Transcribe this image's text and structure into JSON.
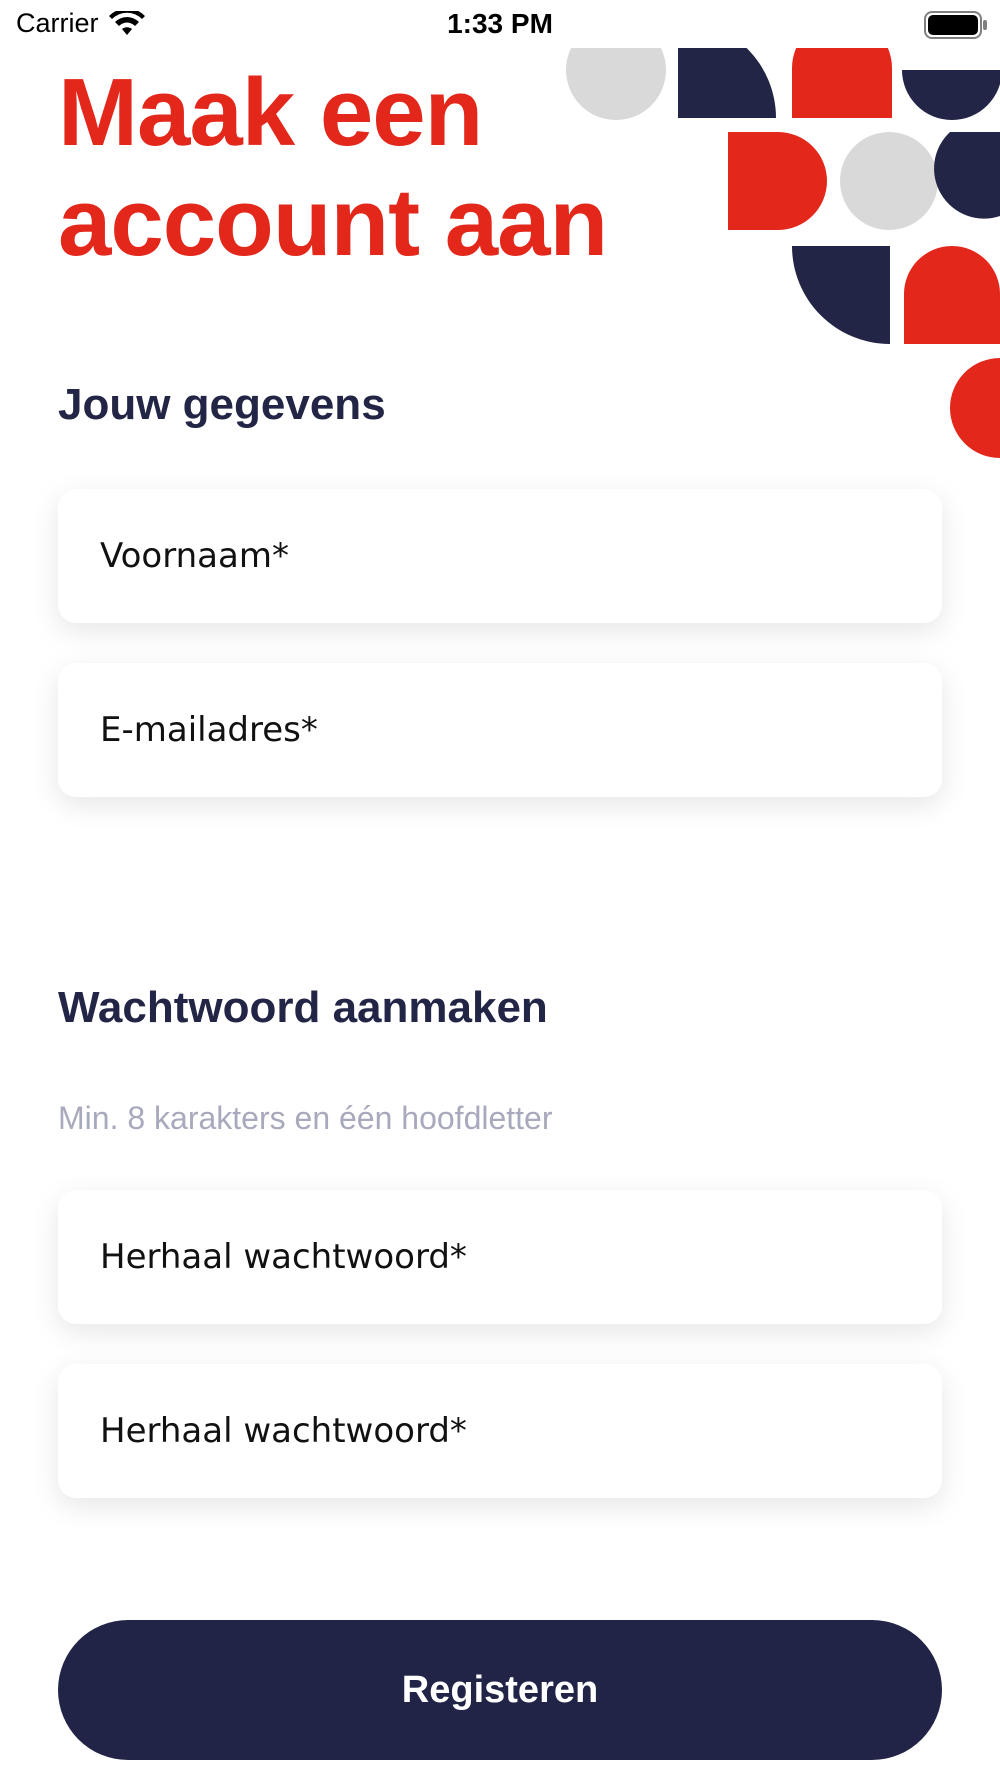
{
  "status_bar": {
    "carrier": "Carrier",
    "time": "1:33 PM",
    "icons": [
      "wifi-icon",
      "battery-icon"
    ]
  },
  "colors": {
    "brand_red": "#e3271b",
    "navy": "#222545",
    "light_gray": "#d9d9d9",
    "hint_gray": "#a9a9bd"
  },
  "page": {
    "title_line1": "Maak een",
    "title_line2": "account aan"
  },
  "details_section": {
    "title": "Jouw gegevens",
    "first_name_placeholder": "Voornaam*",
    "email_placeholder": "E-mailadres*"
  },
  "password_section": {
    "title": "Wachtwoord aanmaken",
    "hint": "Min. 8 karakters en één hoofdletter",
    "password_placeholder": "Herhaal wachtwoord*",
    "repeat_password_placeholder": "Herhaal wachtwoord*"
  },
  "actions": {
    "register_label": "Registeren"
  }
}
